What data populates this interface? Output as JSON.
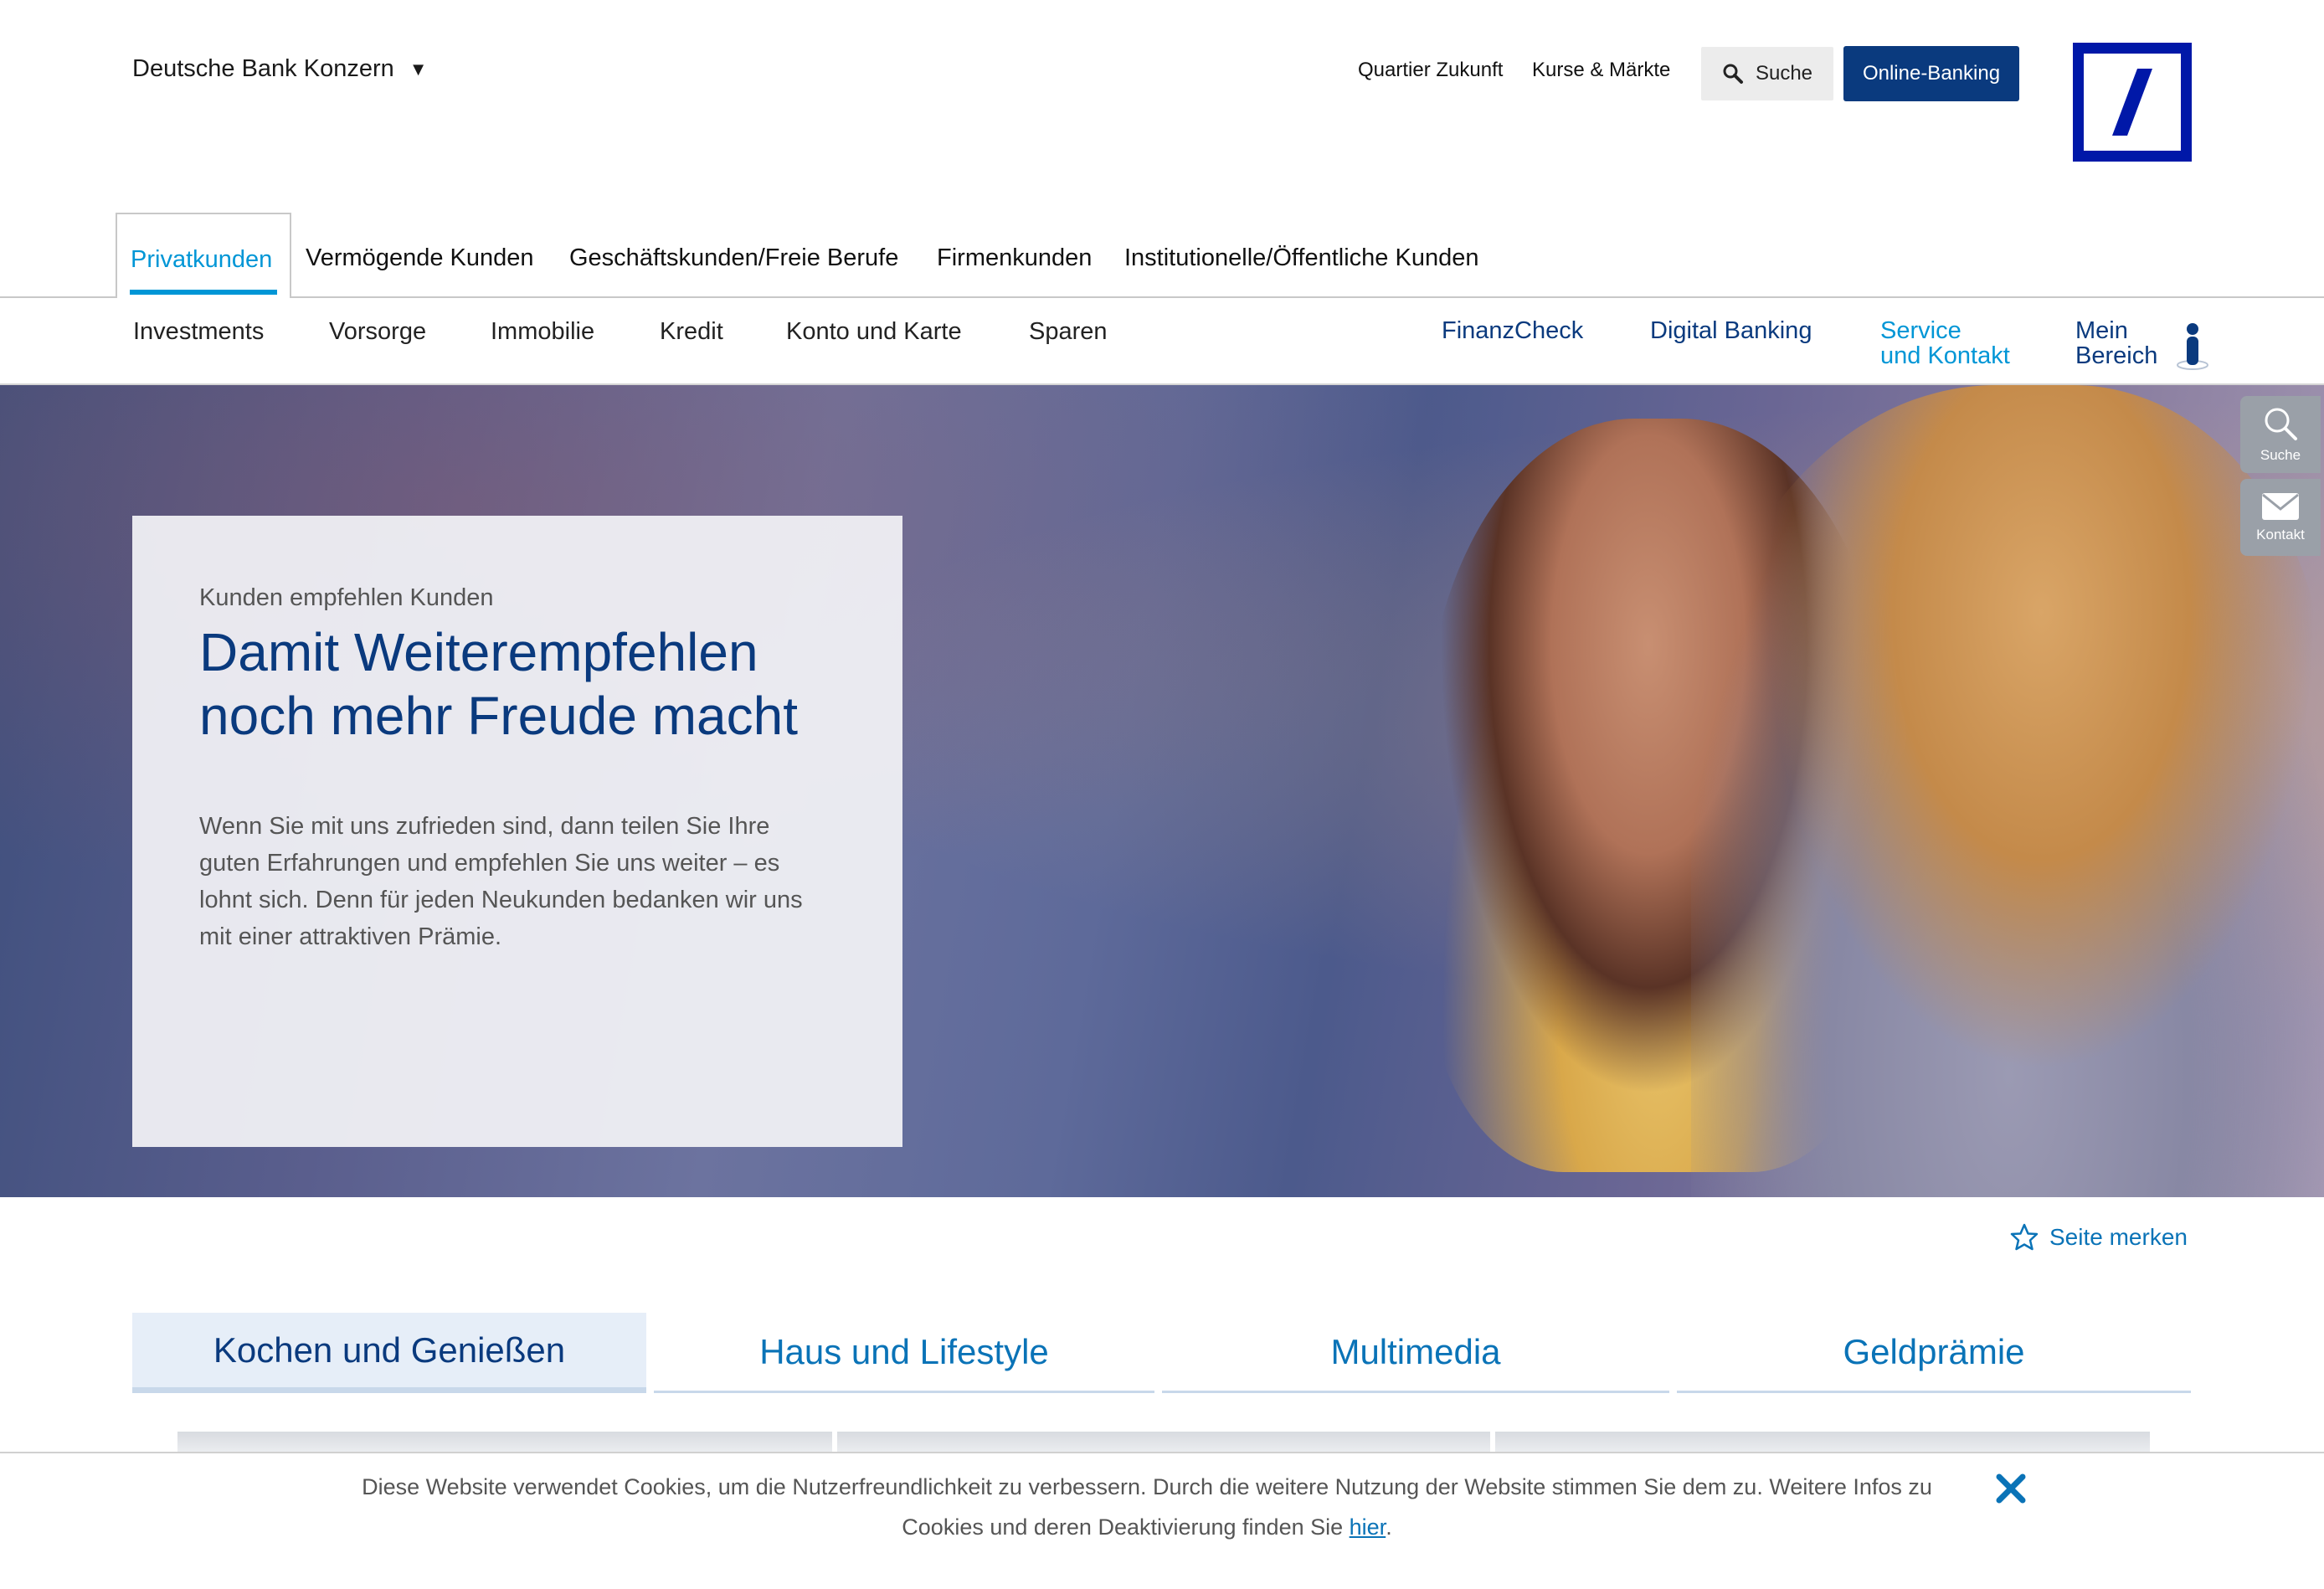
{
  "header": {
    "konzern_label": "Deutsche Bank Konzern",
    "links": [
      "Quartier Zukunft",
      "Kurse & Märkte"
    ],
    "search_label": "Suche",
    "online_banking_label": "Online-Banking"
  },
  "segments": [
    "Privatkunden",
    "Vermögende Kunden",
    "Geschäftskunden/Freie Berufe",
    "Firmenkunden",
    "Institutionelle/Öffentliche Kunden"
  ],
  "subnav": {
    "left": [
      "Investments",
      "Vorsorge",
      "Immobilie",
      "Kredit",
      "Konto und Karte",
      "Sparen"
    ],
    "finanzcheck": "FinanzCheck",
    "digital_banking": "Digital Banking",
    "service_line1": "Service",
    "service_line2": "und Kontakt",
    "mein_line1": "Mein",
    "mein_line2": "Bereich"
  },
  "hero": {
    "kicker": "Kunden empfehlen Kunden",
    "headline_line1": "Damit Weiterempfehlen",
    "headline_line2": "noch mehr Freude macht",
    "body": "Wenn Sie mit uns zufrieden sind, dann teilen Sie Ihre guten Erfahrungen und empfehlen Sie uns weiter – es lohnt sich. Denn für jeden Neukunden bedanken wir uns mit einer attraktiven Prämie."
  },
  "sidetools": {
    "search_label": "Suche",
    "contact_label": "Kontakt"
  },
  "bookmark_label": "Seite merken",
  "category_tabs": [
    "Kochen und Genießen",
    "Haus und Lifestyle",
    "Multimedia",
    "Geldprämie"
  ],
  "cookie": {
    "text": "Diese Website verwendet Cookies, um die Nutzerfreundlichkeit zu verbessern. Durch die weitere Nutzung der Website stimmen Sie dem zu. Weitere Infos zu Cookies und deren Deaktivierung finden Sie ",
    "link_label": "hier",
    "end": "."
  },
  "colors": {
    "brand_blue": "#0018a8",
    "navy": "#0a3a7e",
    "link_blue": "#0a73b7",
    "active_accent": "#0096d6"
  }
}
